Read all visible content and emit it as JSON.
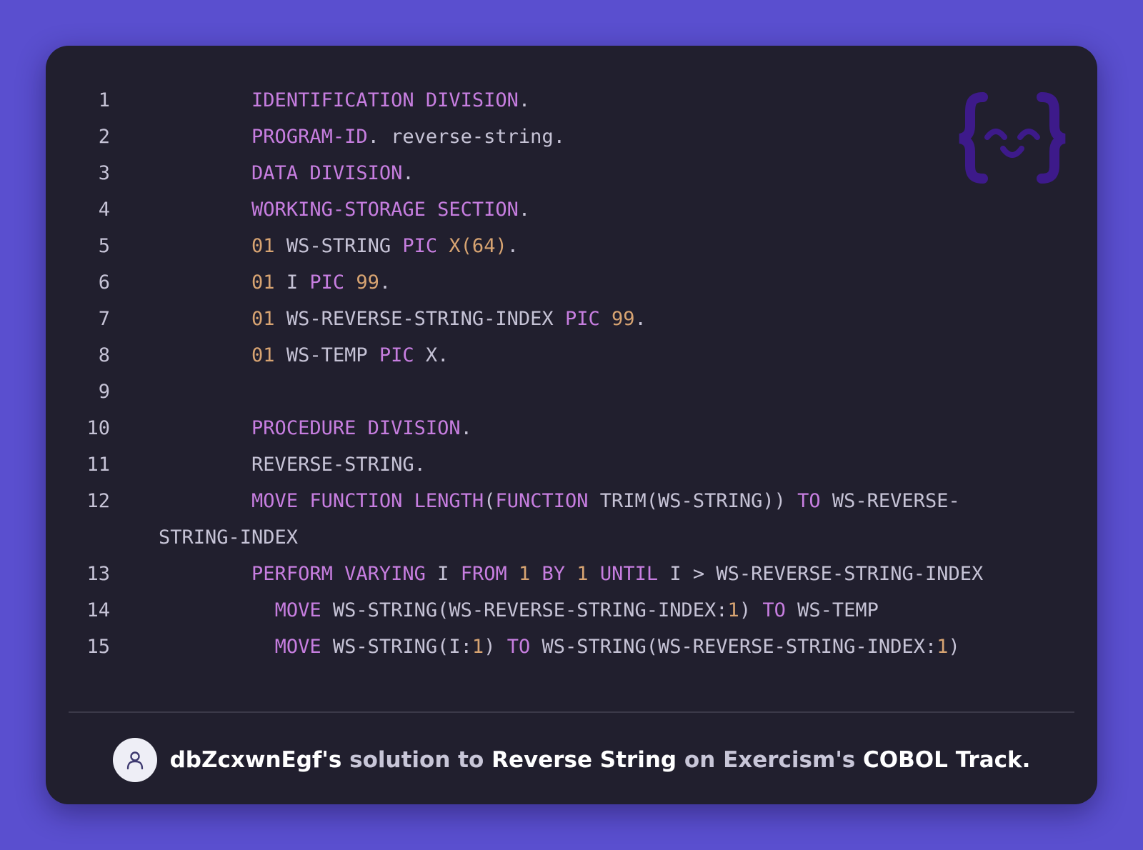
{
  "colors": {
    "background": "#5a4fcf",
    "card": "#211f2e",
    "keyword": "#c77ee0",
    "number": "#d8a472",
    "text": "#c6c3d6",
    "logo": "#3d1a8a"
  },
  "logo_icon": "exercism-curly-face-icon",
  "code_lines": [
    {
      "num": "1",
      "tokens": [
        {
          "t": "        ",
          "c": "t"
        },
        {
          "t": "IDENTIFICATION DIVISION",
          "c": "k"
        },
        {
          "t": ".",
          "c": "t"
        }
      ]
    },
    {
      "num": "2",
      "tokens": [
        {
          "t": "        ",
          "c": "t"
        },
        {
          "t": "PROGRAM-ID",
          "c": "k"
        },
        {
          "t": ". reverse-string.",
          "c": "t"
        }
      ]
    },
    {
      "num": "3",
      "tokens": [
        {
          "t": "        ",
          "c": "t"
        },
        {
          "t": "DATA DIVISION",
          "c": "k"
        },
        {
          "t": ".",
          "c": "t"
        }
      ]
    },
    {
      "num": "4",
      "tokens": [
        {
          "t": "        ",
          "c": "t"
        },
        {
          "t": "WORKING-STORAGE SECTION",
          "c": "k"
        },
        {
          "t": ".",
          "c": "t"
        }
      ]
    },
    {
      "num": "5",
      "tokens": [
        {
          "t": "        ",
          "c": "t"
        },
        {
          "t": "01",
          "c": "n"
        },
        {
          "t": " WS-STRING ",
          "c": "t"
        },
        {
          "t": "PIC",
          "c": "k"
        },
        {
          "t": " ",
          "c": "t"
        },
        {
          "t": "X(64)",
          "c": "n"
        },
        {
          "t": ".",
          "c": "t"
        }
      ]
    },
    {
      "num": "6",
      "tokens": [
        {
          "t": "        ",
          "c": "t"
        },
        {
          "t": "01",
          "c": "n"
        },
        {
          "t": " I ",
          "c": "t"
        },
        {
          "t": "PIC",
          "c": "k"
        },
        {
          "t": " ",
          "c": "t"
        },
        {
          "t": "99",
          "c": "n"
        },
        {
          "t": ".",
          "c": "t"
        }
      ]
    },
    {
      "num": "7",
      "tokens": [
        {
          "t": "        ",
          "c": "t"
        },
        {
          "t": "01",
          "c": "n"
        },
        {
          "t": " WS-REVERSE-STRING-INDEX ",
          "c": "t"
        },
        {
          "t": "PIC",
          "c": "k"
        },
        {
          "t": " ",
          "c": "t"
        },
        {
          "t": "99",
          "c": "n"
        },
        {
          "t": ".",
          "c": "t"
        }
      ]
    },
    {
      "num": "8",
      "tokens": [
        {
          "t": "        ",
          "c": "t"
        },
        {
          "t": "01",
          "c": "n"
        },
        {
          "t": " WS-TEMP ",
          "c": "t"
        },
        {
          "t": "PIC",
          "c": "k"
        },
        {
          "t": " X.",
          "c": "t"
        }
      ]
    },
    {
      "num": "9",
      "tokens": []
    },
    {
      "num": "10",
      "tokens": [
        {
          "t": "        ",
          "c": "t"
        },
        {
          "t": "PROCEDURE DIVISION",
          "c": "k"
        },
        {
          "t": ".",
          "c": "t"
        }
      ]
    },
    {
      "num": "11",
      "tokens": [
        {
          "t": "        ",
          "c": "t"
        },
        {
          "t": "REVERSE-STRING.",
          "c": "t"
        }
      ]
    },
    {
      "num": "12",
      "tokens": [
        {
          "t": "        ",
          "c": "t"
        },
        {
          "t": "MOVE",
          "c": "k"
        },
        {
          "t": " ",
          "c": "t"
        },
        {
          "t": "FUNCTION",
          "c": "k"
        },
        {
          "t": " ",
          "c": "t"
        },
        {
          "t": "LENGTH",
          "c": "k"
        },
        {
          "t": "(",
          "c": "t"
        },
        {
          "t": "FUNCTION",
          "c": "k"
        },
        {
          "t": " TRIM(WS-STRING)) ",
          "c": "t"
        },
        {
          "t": "TO",
          "c": "k"
        },
        {
          "t": " WS-REVERSE-",
          "c": "t"
        }
      ],
      "wrap": "STRING-INDEX"
    },
    {
      "num": "13",
      "tokens": [
        {
          "t": "        ",
          "c": "t"
        },
        {
          "t": "PERFORM",
          "c": "k"
        },
        {
          "t": " ",
          "c": "t"
        },
        {
          "t": "VARYING",
          "c": "k"
        },
        {
          "t": " I ",
          "c": "t"
        },
        {
          "t": "FROM",
          "c": "k"
        },
        {
          "t": " ",
          "c": "t"
        },
        {
          "t": "1",
          "c": "n"
        },
        {
          "t": " ",
          "c": "t"
        },
        {
          "t": "BY",
          "c": "k"
        },
        {
          "t": " ",
          "c": "t"
        },
        {
          "t": "1",
          "c": "n"
        },
        {
          "t": " ",
          "c": "t"
        },
        {
          "t": "UNTIL",
          "c": "k"
        },
        {
          "t": " I > WS-REVERSE-STRING-INDEX",
          "c": "t"
        }
      ]
    },
    {
      "num": "14",
      "tokens": [
        {
          "t": "          ",
          "c": "t"
        },
        {
          "t": "MOVE",
          "c": "k"
        },
        {
          "t": " WS-STRING(WS-REVERSE-STRING-INDEX:",
          "c": "t"
        },
        {
          "t": "1",
          "c": "n"
        },
        {
          "t": ") ",
          "c": "t"
        },
        {
          "t": "TO",
          "c": "k"
        },
        {
          "t": " WS-TEMP",
          "c": "t"
        }
      ]
    },
    {
      "num": "15",
      "tokens": [
        {
          "t": "          ",
          "c": "t"
        },
        {
          "t": "MOVE",
          "c": "k"
        },
        {
          "t": " WS-STRING(I:",
          "c": "t"
        },
        {
          "t": "1",
          "c": "n"
        },
        {
          "t": ") ",
          "c": "t"
        },
        {
          "t": "TO",
          "c": "k"
        },
        {
          "t": " WS-STRING(WS-REVERSE-STRING-INDEX:",
          "c": "t"
        },
        {
          "t": "1",
          "c": "n"
        },
        {
          "t": ")",
          "c": "t"
        }
      ]
    }
  ],
  "footer": {
    "avatar_icon": "user-icon",
    "author": "dbZcxwnEgf",
    "possessive": "'s",
    "solution_to": " solution to ",
    "exercise": "Reverse String",
    "on": " on ",
    "site": "Exercism",
    "site_possessive": "'s",
    "track": " COBOL Track."
  }
}
